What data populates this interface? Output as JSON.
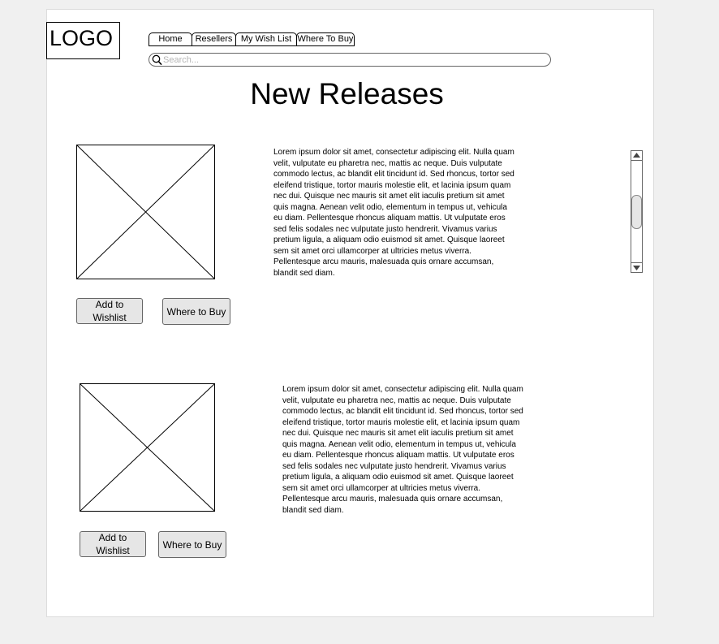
{
  "logo": "LOGO",
  "nav": {
    "tabs": [
      "Home",
      "Resellers",
      "My Wish List",
      "Where To Buy"
    ]
  },
  "search": {
    "placeholder": "Search..."
  },
  "page_title": "New Releases",
  "products": [
    {
      "description": "Lorem ipsum dolor sit amet, consectetur adipiscing elit. Nulla quam velit, vulputate eu pharetra nec, mattis ac neque. Duis vulputate commodo lectus, ac blandit elit tincidunt id. Sed rhoncus, tortor sed eleifend tristique, tortor mauris molestie elit, et lacinia ipsum quam nec dui. Quisque nec mauris sit amet elit iaculis pretium sit amet quis magna. Aenean velit odio, elementum in tempus ut, vehicula eu diam. Pellentesque rhoncus aliquam mattis. Ut vulputate eros sed felis sodales nec vulputate justo hendrerit. Vivamus varius pretium ligula, a aliquam odio euismod sit amet. Quisque laoreet sem sit amet orci ullamcorper at ultricies metus viverra. Pellentesque arcu mauris, malesuada quis ornare accumsan, blandit sed diam.",
      "wishlist_label": "Add to Wishlist",
      "where_label": "Where to Buy"
    },
    {
      "description": "Lorem ipsum dolor sit amet, consectetur adipiscing elit. Nulla quam velit, vulputate eu pharetra nec, mattis ac neque. Duis vulputate commodo lectus, ac blandit elit tincidunt id. Sed rhoncus, tortor sed eleifend tristique, tortor mauris molestie elit, et lacinia ipsum quam nec dui. Quisque nec mauris sit amet elit iaculis pretium sit amet quis magna. Aenean velit odio, elementum in tempus ut, vehicula eu diam. Pellentesque rhoncus aliquam mattis. Ut vulputate eros sed felis sodales nec vulputate justo hendrerit. Vivamus varius pretium ligula, a aliquam odio euismod sit amet. Quisque laoreet sem sit amet orci ullamcorper at ultricies metus viverra. Pellentesque arcu mauris, malesuada quis ornare accumsan, blandit sed diam.",
      "wishlist_label": "Add to Wishlist",
      "where_label": "Where to Buy"
    }
  ],
  "icons": {
    "search": "search-icon",
    "image_placeholder": "image-placeholder-icon",
    "scroll_up": "scroll-up-arrow-icon",
    "scroll_down": "scroll-down-arrow-icon"
  },
  "colors": {
    "page_background": "#f0f0f0",
    "canvas": "#ffffff",
    "button_fill": "#e6e6e6",
    "border": "#666666",
    "placeholder_text": "#b5b5b5"
  }
}
